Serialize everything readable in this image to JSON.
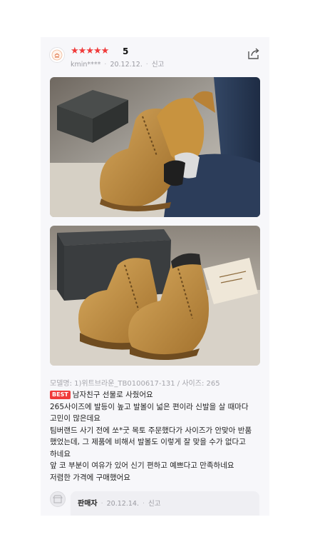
{
  "review": {
    "rating_stars": 5,
    "rating_text": "5",
    "author": "kmin****",
    "date": "20.12.12.",
    "report_label": "신고",
    "share_icon": "share-icon",
    "model_info": "모델명: 1)위트브라운_TB0100617-131 / 사이즈: 265",
    "badge": "BEST",
    "body_lines": [
      "남자친구 선물로 사줬어요",
      "265사이즈에 발등이 높고 발볼이 넓은 편이라 신발을 살 때마다",
      "고민이 많은데요",
      "팀버랜드 사기 전에 쏘*굿 목토 주문했다가 사이즈가 안맞아 반품",
      "했었는데, 그 제품에 비해서 발볼도 이렇게 잘 맞을 수가 없다고",
      "하네요",
      "앞 코 부분이 여유가 있어 신기 편하고 예쁘다고 만족하네요",
      "저렴한 가격에 구매했어요"
    ]
  },
  "reply": {
    "seller_label": "판매자",
    "date": "20.12.14.",
    "report_label": "신고"
  },
  "colors": {
    "star": "#f03b3b",
    "badge": "#f03b3b",
    "card_bg": "#f7f7fa"
  }
}
